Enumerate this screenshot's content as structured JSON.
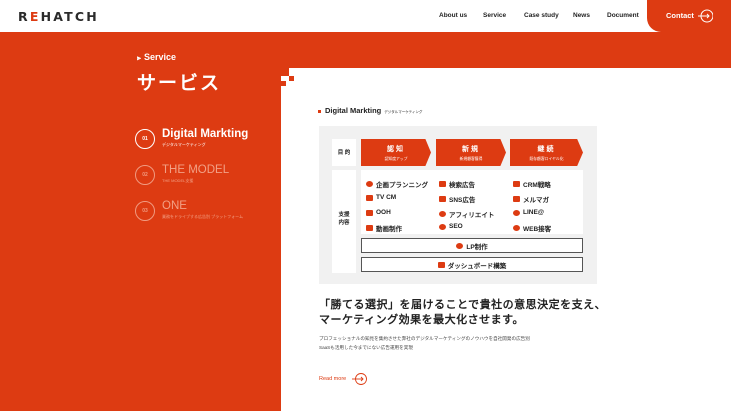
{
  "header": {
    "logo": {
      "part1": "R",
      "part2": "E",
      "part3": "HATCH"
    },
    "nav": [
      "About us",
      "Service",
      "Case study",
      "News",
      "Document"
    ],
    "contact_label": "Contact"
  },
  "section": {
    "label": "Service",
    "title": "サービス"
  },
  "menu": [
    {
      "num": "01",
      "title": "Digital Markting",
      "sub": "デジタルマーケティング",
      "active": true
    },
    {
      "num": "02",
      "title": "THE MODEL",
      "sub": "THE MODEL支援",
      "active": false
    },
    {
      "num": "03",
      "title": "ONE",
      "sub": "業務をドライブする広告別 プラットフォーム",
      "active": false
    }
  ],
  "content": {
    "heading": "Digital Markting",
    "heading_sub": "デジタルマーケティング",
    "row_purpose": "目 的",
    "row_support_1": "支援",
    "row_support_2": "内容",
    "stages": [
      {
        "title": "認知",
        "sub": "認知度アップ"
      },
      {
        "title": "新規",
        "sub": "新規顧客獲得"
      },
      {
        "title": "継続",
        "sub": "既存顧客ロイヤル化"
      }
    ],
    "col1": [
      "企画プランニング",
      "TV CM",
      "OOH",
      "動画制作"
    ],
    "col2": [
      "検索広告",
      "SNS広告",
      "アフィリエイト",
      "SEO"
    ],
    "col3": [
      "CRM戦略",
      "メルマガ",
      "LINE@",
      "WEB接客"
    ],
    "lp_label": "LP制作",
    "dashboard_label": "ダッシュボード構築",
    "lead_line1": "「勝てる選択」を届けることで貴社の意思決定を支え、",
    "lead_line2": "マーケティング効果を最大化させます。",
    "desc_line1": "プロフェッショナルの知見を集約させた弊社のデジタルマーケティングのノウハウを自社開発の広告別",
    "desc_line2": "SaaSも活用した今までにない広告運用を実現",
    "readmore": "Read more"
  },
  "colors": {
    "accent": "#dd3b12"
  }
}
